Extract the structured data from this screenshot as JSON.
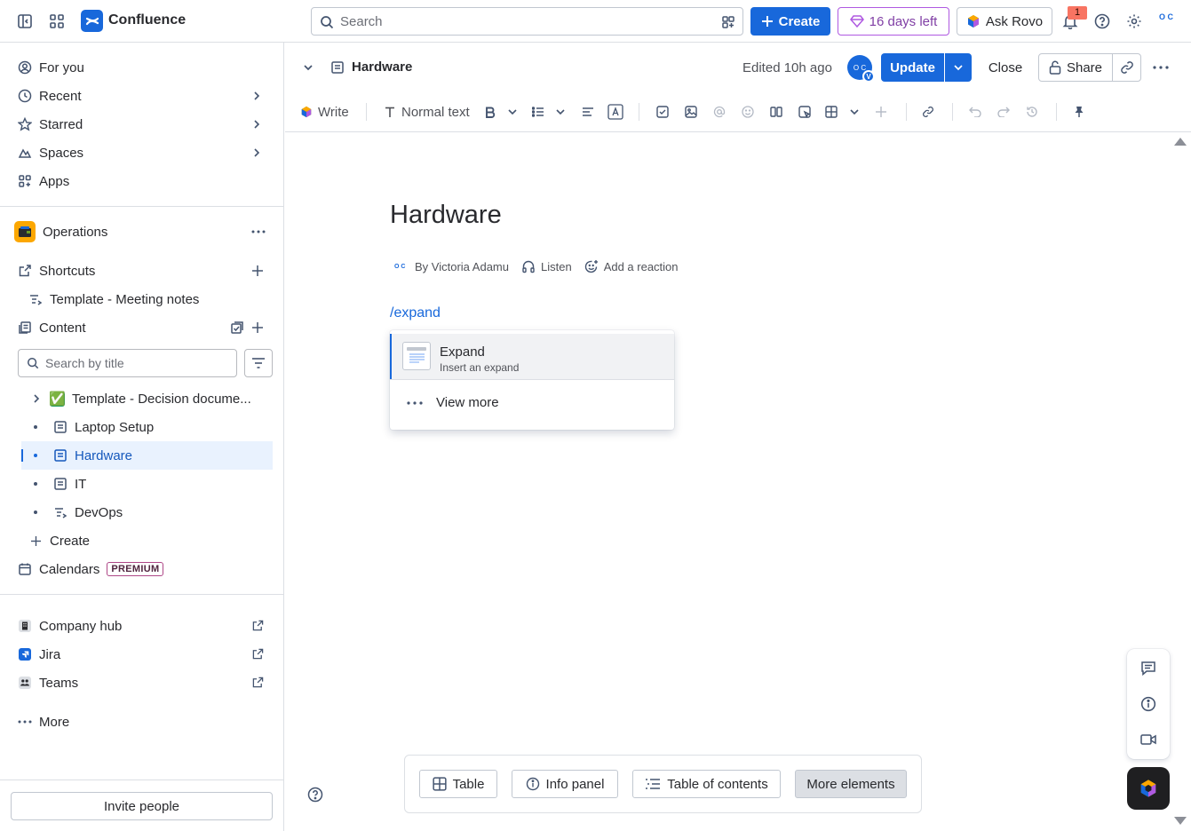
{
  "app": {
    "name": "Confluence",
    "search_placeholder": "Search",
    "create_label": "Create",
    "trial_label": "16 days left",
    "rovo_label": "Ask Rovo",
    "notification_count": "1",
    "user_initials": "O C"
  },
  "sidebar": {
    "nav": [
      {
        "label": "For you"
      },
      {
        "label": "Recent"
      },
      {
        "label": "Starred"
      },
      {
        "label": "Spaces"
      },
      {
        "label": "Apps"
      }
    ],
    "space_name": "Operations",
    "shortcuts_label": "Shortcuts",
    "shortcut_item": "Template - Meeting notes",
    "content_label": "Content",
    "search_placeholder": "Search by title",
    "tree": [
      {
        "label": "Template - Decision docume...",
        "emoji": "✅"
      },
      {
        "label": "Laptop Setup"
      },
      {
        "label": "Hardware"
      },
      {
        "label": "IT"
      },
      {
        "label": "DevOps"
      }
    ],
    "create_label": "Create",
    "calendars_label": "Calendars",
    "premium_badge": "PREMIUM",
    "apps": [
      {
        "label": "Company hub"
      },
      {
        "label": "Jira"
      },
      {
        "label": "Teams"
      }
    ],
    "more_label": "More",
    "invite_label": "Invite people"
  },
  "page_header": {
    "title": "Hardware",
    "edited": "Edited 10h ago",
    "avatar_initials": "O C",
    "avatar_sub": "V",
    "update_label": "Update",
    "close_label": "Close",
    "share_label": "Share"
  },
  "toolbar": {
    "write_label": "Write",
    "text_style": "Normal text"
  },
  "content": {
    "title": "Hardware",
    "byline": "By Victoria Adamu",
    "byline_initials": "O C",
    "listen_label": "Listen",
    "reaction_label": "Add a reaction",
    "slash_command": "/expand"
  },
  "slash_menu": {
    "item_title": "Expand",
    "item_desc": "Insert an expand",
    "view_more": "View more"
  },
  "element_bar": {
    "buttons": [
      {
        "label": "Table"
      },
      {
        "label": "Info panel"
      },
      {
        "label": "Table of contents"
      },
      {
        "label": "More elements"
      }
    ]
  },
  "colors": {
    "brand_blue": "#1868db",
    "trial_purple": "#af59e1",
    "active_bg": "#e9f2fe"
  }
}
